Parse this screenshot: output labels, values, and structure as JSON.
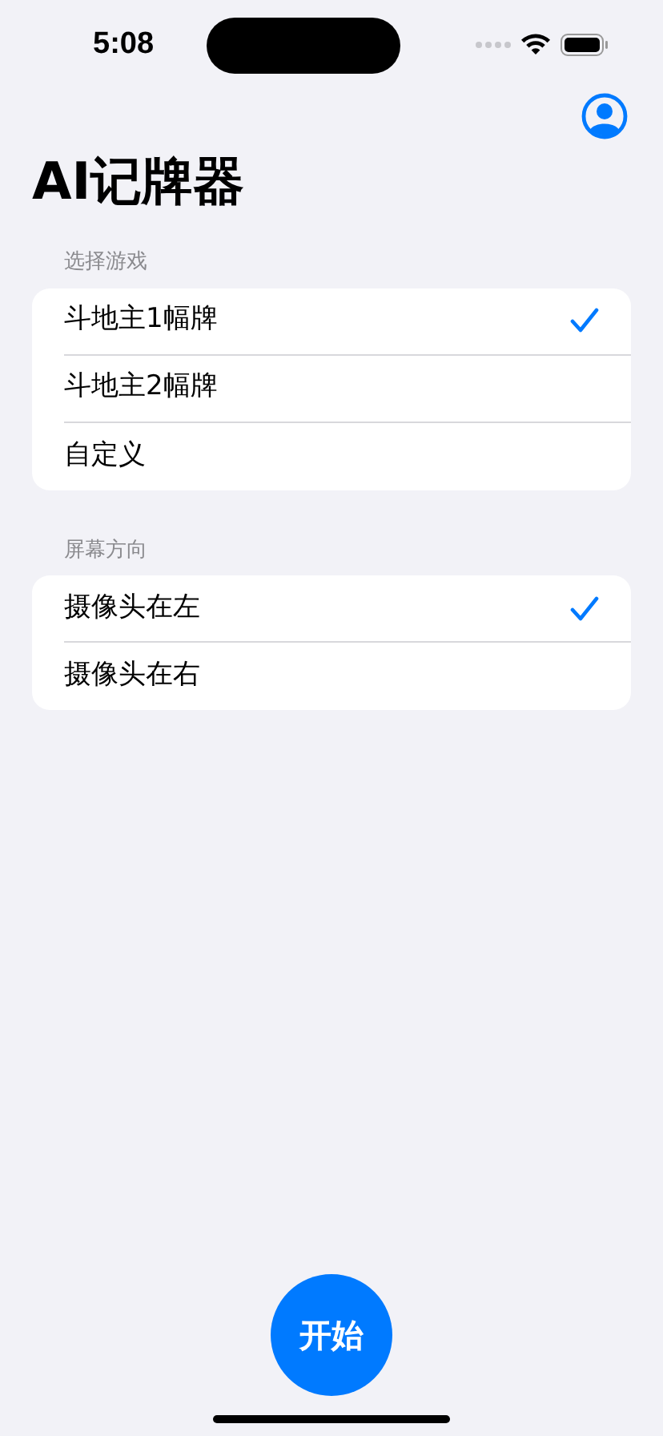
{
  "status_bar": {
    "time": "5:08"
  },
  "title": "AI记牌器",
  "sections": [
    {
      "header": "选择游戏",
      "options": [
        {
          "label": "斗地主1幅牌",
          "selected": true
        },
        {
          "label": "斗地主2幅牌",
          "selected": false
        },
        {
          "label": "自定义",
          "selected": false
        }
      ]
    },
    {
      "header": "屏幕方向",
      "options": [
        {
          "label": "摄像头在左",
          "selected": true
        },
        {
          "label": "摄像头在右",
          "selected": false
        }
      ]
    }
  ],
  "start_button": "开始"
}
